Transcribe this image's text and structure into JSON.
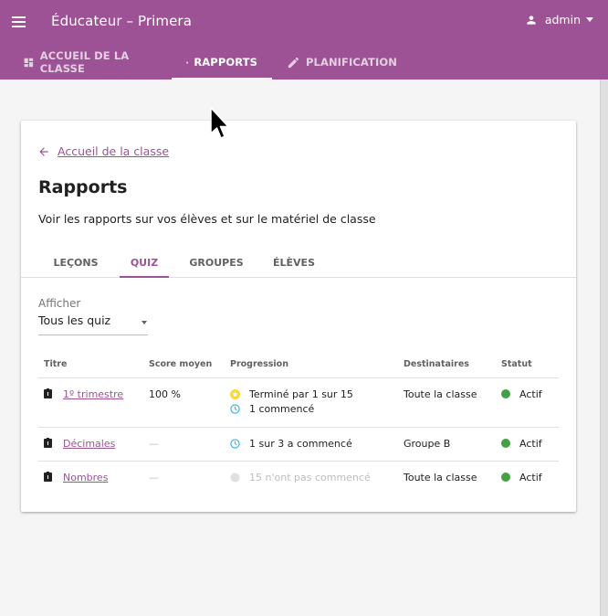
{
  "app": {
    "title": "Éducateur – Primera",
    "user_label": "admin"
  },
  "nav_tabs": [
    {
      "label": "ACCUEIL DE LA CLASSE",
      "icon": "dashboard-icon"
    },
    {
      "label": "RAPPORTS",
      "icon": "bar-chart-icon"
    },
    {
      "label": "PLANIFICATION",
      "icon": "pencil-icon"
    }
  ],
  "page": {
    "back_label": "Accueil de la classe",
    "title": "Rapports",
    "description": "Voir les rapports sur vos élèves et sur le matériel de classe"
  },
  "subtabs": [
    "LEÇONS",
    "QUIZ",
    "GROUPES",
    "ÉLÈVES"
  ],
  "filter": {
    "label": "Afficher",
    "value": "Tous les quiz"
  },
  "table": {
    "headers": [
      "Titre",
      "Score moyen",
      "Progression",
      "Destinataires",
      "Statut"
    ],
    "rows": [
      {
        "title": "1º trimestre",
        "score": "100 %",
        "progress": [
          "Terminé par 1 sur 15",
          "1 commencé"
        ],
        "recipients": "Toute la classe",
        "status": "Actif"
      },
      {
        "title": "Décimales",
        "score": "—",
        "progress": [
          "1 sur 3 a commencé"
        ],
        "recipients": "Groupe B",
        "status": "Actif"
      },
      {
        "title": "Nombres",
        "score": "—",
        "progress": [
          "15 n'ont pas commencé"
        ],
        "recipients": "Toute la classe",
        "status": "Actif"
      }
    ]
  },
  "colors": {
    "brand": "#9c5294",
    "status_active": "#43a047",
    "star": "#fdd835",
    "clock": "#29b6f6"
  }
}
